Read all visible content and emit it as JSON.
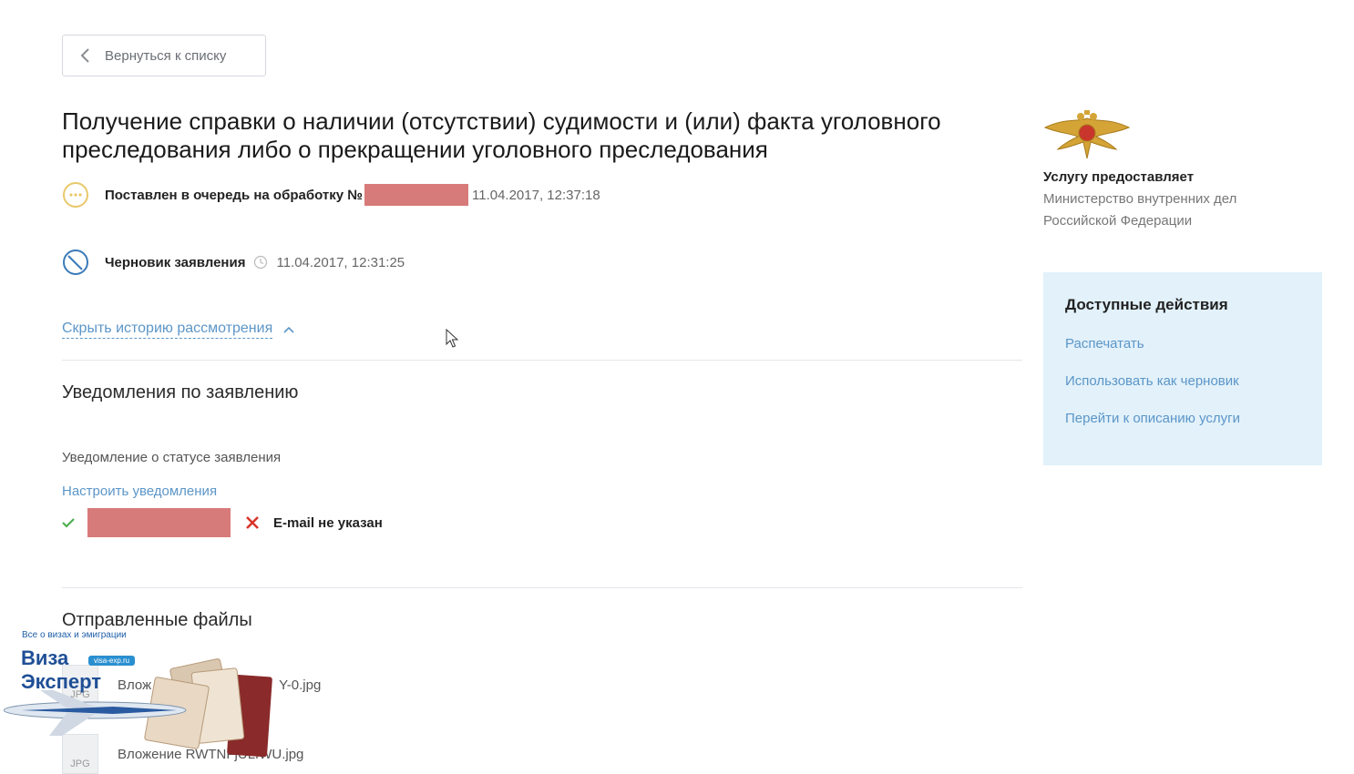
{
  "back_button": {
    "label": "Вернуться к списку"
  },
  "title": "Получение справки о наличии (отсутствии) судимости и (или) факта уголовного преследования либо о прекращении уголовного преследования",
  "statuses": [
    {
      "label": "Поставлен в очередь на обработку №",
      "datetime": "11.04.2017, 12:37:18"
    },
    {
      "label": "Черновик заявления",
      "datetime": "11.04.2017, 12:31:25"
    }
  ],
  "history_toggle": "Скрыть историю рассмотрения",
  "notifications": {
    "title": "Уведомления по заявлению",
    "subtitle": "Уведомление о статусе заявления",
    "configure_link": "Настроить уведомления",
    "email_status": "E-mail не указан"
  },
  "files": {
    "title": "Отправленные файлы",
    "items": [
      {
        "name": "Влож",
        "name_tail": "Y-0.jpg",
        "type": "JPG"
      },
      {
        "name": "Вложение RWTNFjULfWU.jpg",
        "type": "JPG"
      }
    ]
  },
  "provider": {
    "label": "Услугу предоставляет",
    "name": "Министерство внутренних дел Российской Федерации"
  },
  "actions": {
    "title": "Доступные действия",
    "items": [
      "Распечатать",
      "Использовать как черновик",
      "Перейти к описанию услуги"
    ]
  },
  "watermark": {
    "tagline": "Все о визах и эмиграции",
    "brand_line1": "Виза",
    "brand_line2": "Эксперт",
    "url": "visa-exp.ru"
  },
  "colors": {
    "link": "#5c96c8",
    "redaction": "#d77a7a",
    "actions_panel": "#e2f1fa",
    "queued_icon": "#e8c86a",
    "draft_icon": "#3a7bb8",
    "check": "#4caf50",
    "cross": "#d9342b"
  },
  "icons": [
    "chevron-left-icon",
    "ellipsis-circle-icon",
    "no-entry-icon",
    "clock-icon",
    "chevron-up-icon",
    "check-icon",
    "cross-icon",
    "cursor-icon",
    "mvd-emblem-icon"
  ]
}
